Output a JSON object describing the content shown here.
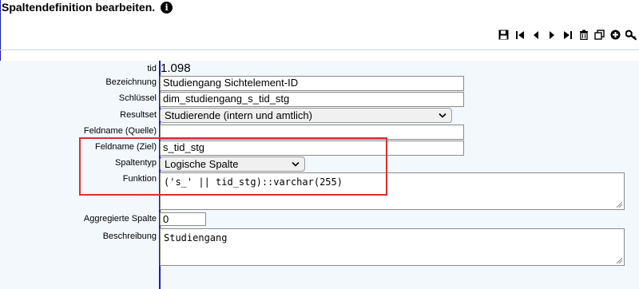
{
  "page": {
    "title": "Spaltendefinition bearbeiten.",
    "info_icon": "info-icon"
  },
  "toolbar": {
    "buttons": [
      {
        "icon": "save-icon"
      },
      {
        "icon": "first-record-icon"
      },
      {
        "icon": "previous-record-icon"
      },
      {
        "icon": "next-record-icon"
      },
      {
        "icon": "last-record-icon"
      },
      {
        "icon": "delete-icon"
      },
      {
        "icon": "copy-icon"
      },
      {
        "icon": "add-icon"
      },
      {
        "icon": "key-icon"
      }
    ]
  },
  "form": {
    "tid": {
      "label": "tid",
      "value": "1.098"
    },
    "bezeichnung": {
      "label": "Bezeichnung",
      "value": "Studiengang Sichtelement-ID"
    },
    "schluessel": {
      "label": "Schlüssel",
      "value": "dim_studiengang_s_tid_stg"
    },
    "resultset": {
      "label": "Resultset",
      "value": "Studierende (intern und amtlich)"
    },
    "feldname_quelle": {
      "label": "Feldname (Quelle)",
      "value": ""
    },
    "feldname_ziel": {
      "label": "Feldname (Ziel)",
      "value": "s_tid_stg"
    },
    "spaltentyp": {
      "label": "Spaltentyp",
      "value": "Logische Spalte"
    },
    "funktion": {
      "label": "Funktion",
      "value": "('s_' || tid_stg)::varchar(255)"
    },
    "aggregierte_spalte": {
      "label": "Aggregierte Spalte",
      "value": "0"
    },
    "beschreibung": {
      "label": "Beschreibung",
      "value": "Studiengang"
    }
  },
  "colors": {
    "accent_line": "#1c1cb5",
    "highlight_border": "#d8302f",
    "panel_background": "#f3f8fd"
  }
}
